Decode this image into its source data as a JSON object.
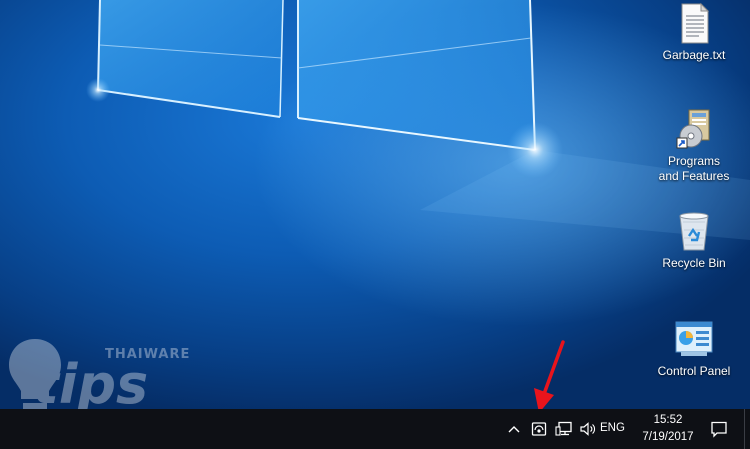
{
  "desktop": {
    "icons": [
      {
        "label": "Garbage.txt",
        "icon": "text-file-icon"
      },
      {
        "label": "Programs\nand Features",
        "icon": "programs-features-icon"
      },
      {
        "label": "Recycle Bin",
        "icon": "recycle-bin-icon"
      },
      {
        "label": "Control Panel",
        "icon": "control-panel-icon"
      }
    ],
    "watermark": {
      "brand": "THAIWARE",
      "word": "tips"
    }
  },
  "taskbar": {
    "tray": {
      "show_hidden_icon": "chevron-up-icon",
      "highlighted_icon": "network-sharing-icon",
      "network_icon": "network-monitor-icon",
      "volume_icon": "speaker-icon",
      "language": "ENG"
    },
    "clock": {
      "time": "15:52",
      "date": "7/19/2017"
    },
    "notification_icon": "action-center-icon"
  },
  "annotation": {
    "arrow_color": "#e8141c"
  }
}
